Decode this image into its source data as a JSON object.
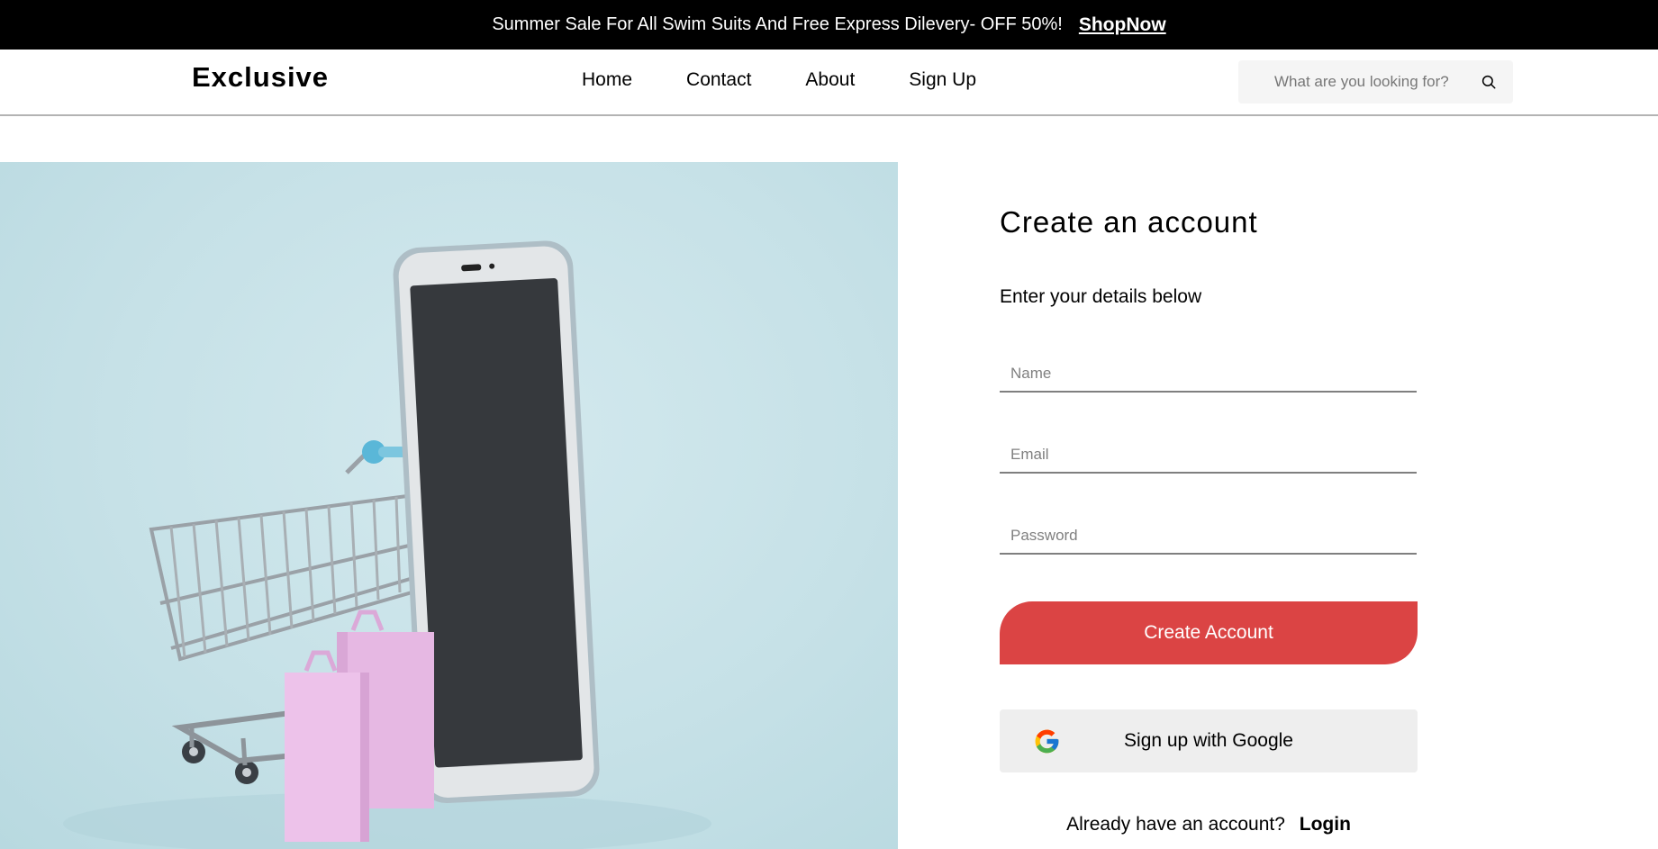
{
  "announcement": {
    "text": "Summer Sale For All Swim Suits And Free Express Dilevery- OFF 50%!",
    "link": "ShopNow"
  },
  "header": {
    "logo": "Exclusive",
    "nav": [
      "Home",
      "Contact",
      "About",
      "Sign Up"
    ],
    "search_placeholder": "What are you looking for?",
    "search_icon": "search-icon"
  },
  "hero": {
    "icon": "shopping-cart-phone-illustration"
  },
  "form": {
    "title": "Create an account",
    "subtitle": "Enter your details below",
    "name_placeholder": "Name",
    "email_placeholder": "Email",
    "password_placeholder": "Password",
    "create_button": "Create Account",
    "google_button": "Sign up with Google",
    "google_icon": "google-icon",
    "login_prompt": "Already have an account?",
    "login_link": "Login"
  },
  "colors": {
    "accent": "#db4444",
    "topbar": "#000000",
    "hero_bg": "#c6e1e7",
    "google_button_bg": "#eeeeee"
  }
}
